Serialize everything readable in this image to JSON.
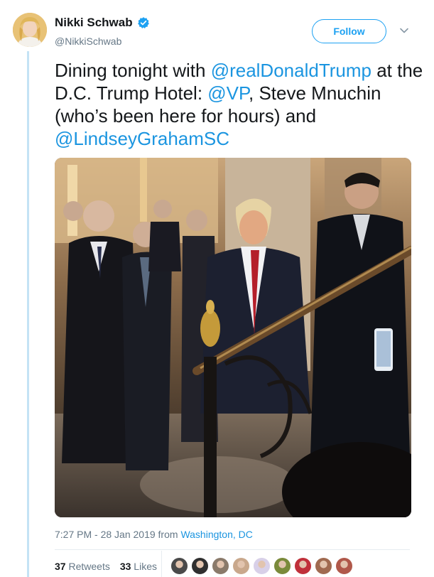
{
  "author": {
    "name": "Nikki Schwab",
    "handle": "@NikkiSchwab",
    "verified": true
  },
  "follow_label": "Follow",
  "tweet": {
    "parts": [
      {
        "text": "Dining tonight with ",
        "mention": false
      },
      {
        "text": "@realDonaldTrump",
        "mention": true
      },
      {
        "text": " at the D.C. Trump Hotel: ",
        "mention": false
      },
      {
        "text": "@VP",
        "mention": true
      },
      {
        "text": ", Steve Mnuchin (who’s been here for hours) and ",
        "mention": false
      },
      {
        "text": "@LindseyGrahamSC",
        "mention": true
      }
    ]
  },
  "meta": {
    "time": "7:27 PM - 28 Jan 2019 from ",
    "location": "Washington, DC"
  },
  "stats": {
    "retweets_count": "37",
    "retweets_label": "Retweets",
    "likes_count": "33",
    "likes_label": "Likes"
  },
  "likers": [
    {
      "name": "liker-1",
      "color": "#4a4a4a"
    },
    {
      "name": "liker-2",
      "color": "#2f2f2f"
    },
    {
      "name": "liker-3",
      "color": "#8a7a6a"
    },
    {
      "name": "liker-4",
      "color": "#c9a88c"
    },
    {
      "name": "liker-5",
      "color": "#d8d0e8"
    },
    {
      "name": "liker-6",
      "color": "#7a8a3a"
    },
    {
      "name": "liker-7",
      "color": "#c0303a"
    },
    {
      "name": "liker-8",
      "color": "#a06a50"
    },
    {
      "name": "liker-9",
      "color": "#b0584a"
    }
  ],
  "colors": {
    "accent": "#1da1f2",
    "link": "#1b95e0",
    "muted": "#657786",
    "thread": "#c4e3f5"
  }
}
